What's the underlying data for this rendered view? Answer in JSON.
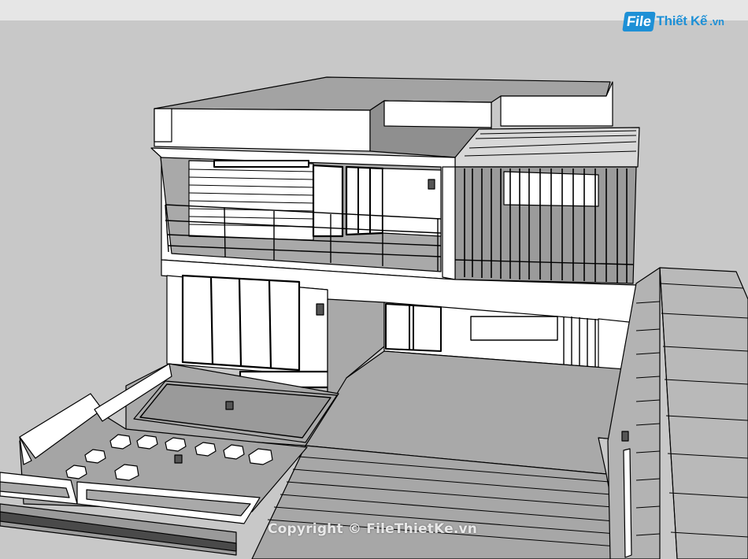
{
  "logo": {
    "box_text": "File",
    "text": "Thiết Kế",
    "ext": ".vn",
    "color": "#1e90d6"
  },
  "watermark": {
    "text": "Copyright © FileThietKe.vn"
  },
  "colors": {
    "background": "#c9c9c9",
    "wall": "#ffffff",
    "shade": "#a9a9a9",
    "line": "#000000"
  }
}
